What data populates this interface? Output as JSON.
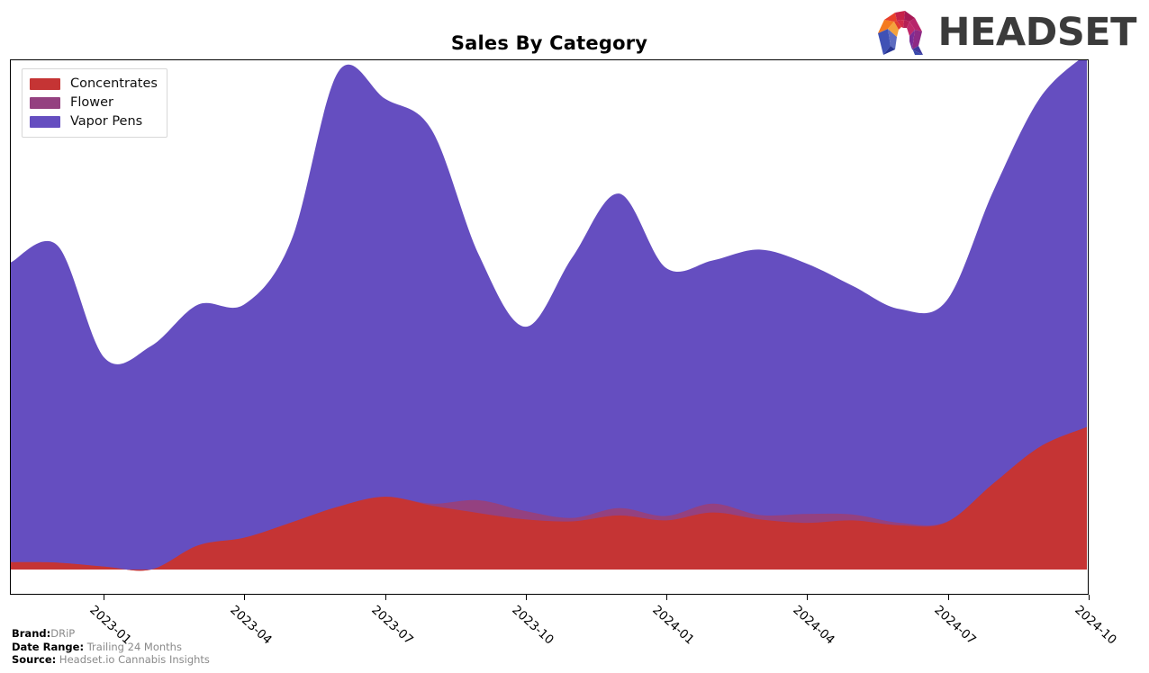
{
  "header": {
    "title": "Sales By Category",
    "logo": {
      "wordmark": "HEADSET",
      "icon_name": "headset-arch-logo"
    }
  },
  "footer": {
    "brand_label": "Brand:",
    "brand_value": "DRiP",
    "date_range_label": "Date Range:",
    "date_range_value": "Trailing 24 Months",
    "source_label": "Source:",
    "source_value": "Headset.io Cannabis Insights"
  },
  "chart_data": {
    "type": "area",
    "stacked": true,
    "title": "Sales By Category",
    "xlabel": "",
    "ylabel": "",
    "grid": false,
    "legend_position": "top-left",
    "axis_tick_labels": [
      "2023-01",
      "2023-04",
      "2023-07",
      "2023-10",
      "2024-01",
      "2024-04",
      "2024-07",
      "2024-10"
    ],
    "x": [
      "2022-11",
      "2022-12",
      "2023-01",
      "2023-02",
      "2023-03",
      "2023-04",
      "2023-05",
      "2023-06",
      "2023-07",
      "2023-08",
      "2023-09",
      "2023-10",
      "2023-11",
      "2023-12",
      "2024-01",
      "2024-02",
      "2024-03",
      "2024-04",
      "2024-05",
      "2024-06",
      "2024-07",
      "2024-08",
      "2024-09",
      "2024-10"
    ],
    "ylim": [
      0,
      100
    ],
    "series": [
      {
        "name": "Concentrates",
        "color": "#c53434",
        "values": [
          1.5,
          1.4,
          0.6,
          0.0,
          4.9,
          6.5,
          9.6,
          12.8,
          14.8,
          13.0,
          11.5,
          10.2,
          9.8,
          11.0,
          10.0,
          11.6,
          10.2,
          9.5,
          10.0,
          9.0,
          9.6,
          17.5,
          25.0,
          29.0
        ]
      },
      {
        "name": "Flower",
        "color": "#944180",
        "values": [
          0.0,
          0.0,
          0.0,
          0.0,
          0.0,
          0.0,
          0.0,
          0.0,
          0.0,
          0.4,
          2.6,
          1.7,
          0.7,
          1.5,
          0.9,
          1.8,
          0.9,
          1.8,
          1.2,
          0.5,
          0.1,
          0.0,
          0.0,
          0.0
        ]
      },
      {
        "name": "Vapor Pens",
        "color": "#654ec0",
        "values": [
          61.0,
          64.5,
          42.5,
          45.5,
          49.0,
          47.5,
          57.5,
          88.5,
          81.0,
          76.0,
          50.0,
          37.5,
          53.0,
          64.0,
          50.5,
          49.5,
          54.0,
          51.0,
          46.5,
          43.5,
          45.0,
          59.5,
          71.0,
          76.0
        ]
      }
    ]
  }
}
